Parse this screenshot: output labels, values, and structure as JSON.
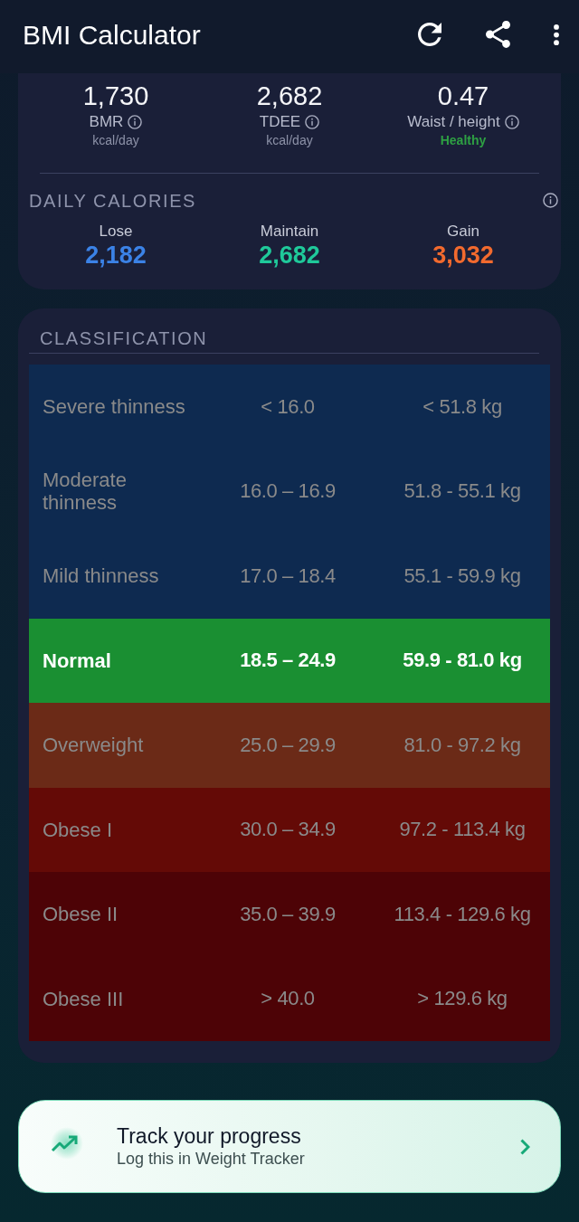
{
  "app_bar": {
    "title": "BMI Calculator"
  },
  "summary": {
    "stats": [
      {
        "value": "1,730",
        "label": "BMR",
        "unit": "kcal/day"
      },
      {
        "value": "2,682",
        "label": "TDEE",
        "unit": "kcal/day"
      },
      {
        "value": "0.47",
        "label": "Waist / height",
        "status": "Healthy"
      }
    ],
    "daily_calories": {
      "title": "DAILY CALORIES",
      "items": [
        {
          "label": "Lose",
          "value": "2,182",
          "color": "#3b82e6"
        },
        {
          "label": "Maintain",
          "value": "2,682",
          "color": "#1fc99a"
        },
        {
          "label": "Gain",
          "value": "3,032",
          "color": "#f26a2e"
        }
      ]
    }
  },
  "classification": {
    "title": "CLASSIFICATION",
    "rows": [
      {
        "category": "Severe thinness",
        "bmi": "< 16.0",
        "weight": "< 51.8 kg",
        "color": "#0e2a50",
        "selected": false
      },
      {
        "category": "Moderate thinness",
        "bmi": "16.0 – 16.9",
        "weight": "51.8 - 55.1 kg",
        "color": "#0e2a50",
        "selected": false
      },
      {
        "category": "Mild thinness",
        "bmi": "17.0 – 18.4",
        "weight": "55.1 - 59.9 kg",
        "color": "#0e2a50",
        "selected": false
      },
      {
        "category": "Normal",
        "bmi": "18.5 – 24.9",
        "weight": "59.9 - 81.0 kg",
        "color": "#1a8f32",
        "selected": true
      },
      {
        "category": "Overweight",
        "bmi": "25.0 – 29.9",
        "weight": "81.0 - 97.2 kg",
        "color": "#6b2a17",
        "selected": false
      },
      {
        "category": "Obese I",
        "bmi": "30.0 – 34.9",
        "weight": "97.2 - 113.4 kg",
        "color": "#640a06",
        "selected": false
      },
      {
        "category": "Obese II",
        "bmi": "35.0 – 39.9",
        "weight": "113.4 - 129.6 kg",
        "color": "#4d0306",
        "selected": false
      },
      {
        "category": "Obese III",
        "bmi": "> 40.0",
        "weight": "> 129.6 kg",
        "color": "#4d0306",
        "selected": false
      }
    ]
  },
  "track_card": {
    "title": "Track your progress",
    "subtitle": "Log this in Weight Tracker"
  }
}
